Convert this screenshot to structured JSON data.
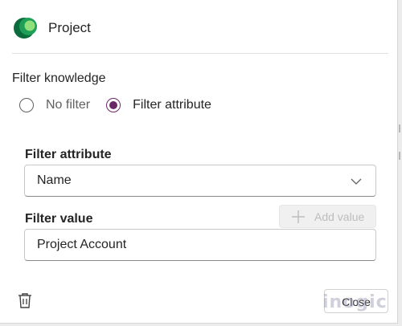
{
  "header": {
    "title": "Project",
    "logo_icon": "dynamics-logo-icon"
  },
  "filter": {
    "section_label": "Filter knowledge",
    "options": [
      {
        "label": "No filter",
        "selected": false
      },
      {
        "label": "Filter attribute",
        "selected": true
      }
    ]
  },
  "attribute": {
    "label": "Filter attribute",
    "selected_value": "Name",
    "chevron_icon": "chevron-down-icon"
  },
  "value": {
    "label": "Filter value",
    "add_button_label": "Add value",
    "add_icon": "plus-icon",
    "input_value": "Project Account"
  },
  "footer": {
    "delete_icon": "trash-icon",
    "close_label": "Close"
  },
  "watermark": "inogic",
  "colors": {
    "accent": "#6b2868",
    "disabled_text": "#bdbdbd"
  }
}
